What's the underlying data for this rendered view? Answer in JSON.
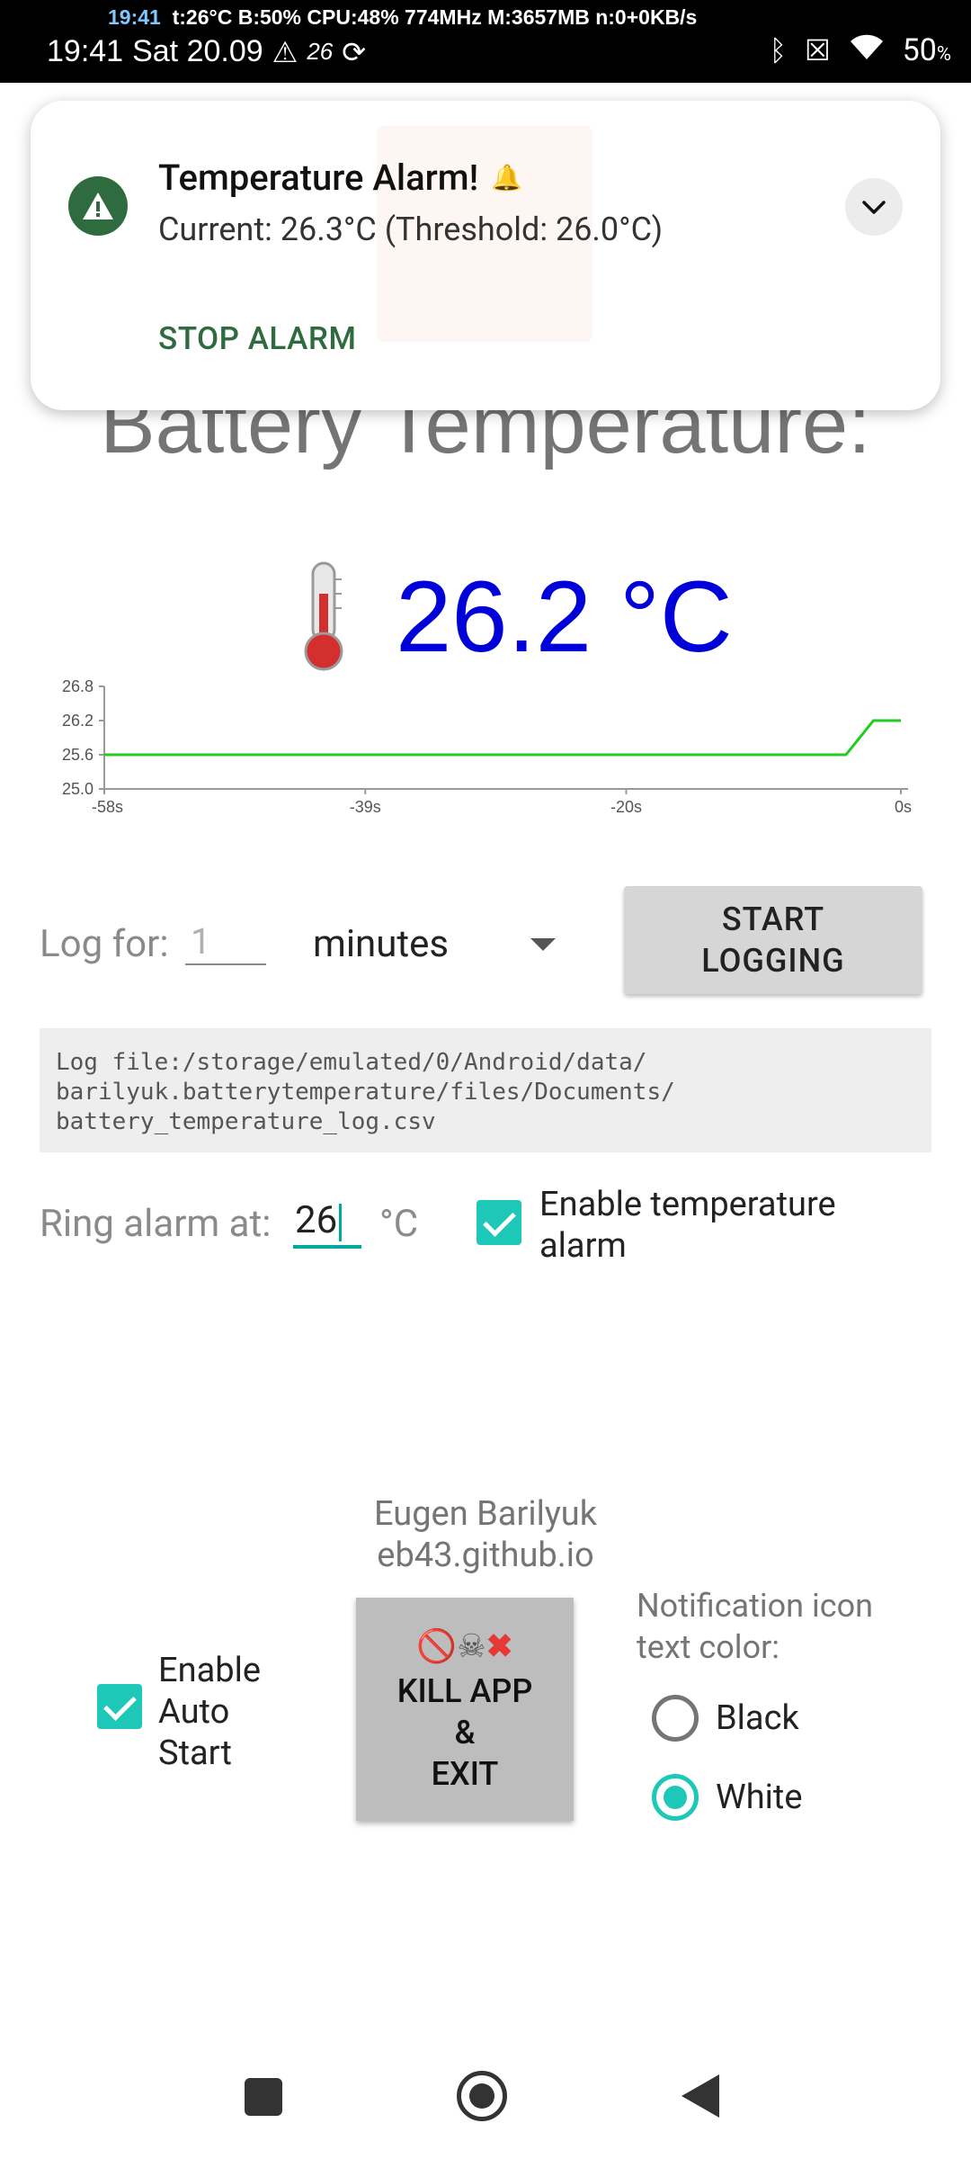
{
  "status_bar": {
    "overlay_time": "19:41",
    "overlay_stats": "t:26°C B:50% CPU:48% 774MHz M:3657MB n:0+0KB/s",
    "clock": "19:41",
    "date": "Sat 20.09",
    "temp_small": "26",
    "battery": "50",
    "battery_unit": "%",
    "icons": [
      "warning-icon",
      "temperature-icon",
      "sync-icon",
      "bluetooth-icon",
      "no-sim-icon",
      "wifi-icon"
    ]
  },
  "notification": {
    "title": "Temperature Alarm!",
    "text": "Current: 26.3°C (Threshold: 26.0°C)",
    "action": "STOP ALARM",
    "icon": "warning-icon"
  },
  "main": {
    "heading": "Battery Temperature:",
    "temperature": "26.2 °C"
  },
  "chart_data": {
    "type": "line",
    "x": [
      -58,
      -4,
      -2,
      0
    ],
    "series": [
      {
        "values": [
          25.6,
          25.6,
          26.2,
          26.2
        ],
        "color": "#22cc22"
      }
    ],
    "x_ticks": [
      "-58s",
      "-39s",
      "-20s",
      "0s"
    ],
    "y_ticks": [
      "25.0",
      "25.6",
      "26.2",
      "26.8"
    ],
    "xlim": [
      -58,
      0
    ],
    "ylim": [
      25.0,
      26.8
    ]
  },
  "logging": {
    "label": "Log for:",
    "duration_placeholder": "1",
    "unit": "minutes",
    "start_button": "START LOGGING",
    "file_path": "Log file:/storage/emulated/0/Android/data/\nbarilyuk.batterytemperature/files/Documents/\nbattery_temperature_log.csv"
  },
  "alarm": {
    "label": "Ring alarm at:",
    "value": "26",
    "unit": "°C",
    "enable_label": "Enable temperature alarm",
    "enabled": true
  },
  "credit": {
    "author": "Eugen Barilyuk",
    "site": "eb43.github.io"
  },
  "autostart": {
    "label": "Enable Auto Start",
    "enabled": true
  },
  "kill": {
    "icons": "🚫☠❌",
    "line1": "KILL APP",
    "line2": "&",
    "line3": "EXIT"
  },
  "notif_color": {
    "label": "Notification icon text color:",
    "options": [
      "Black",
      "White"
    ],
    "selected": "White"
  }
}
